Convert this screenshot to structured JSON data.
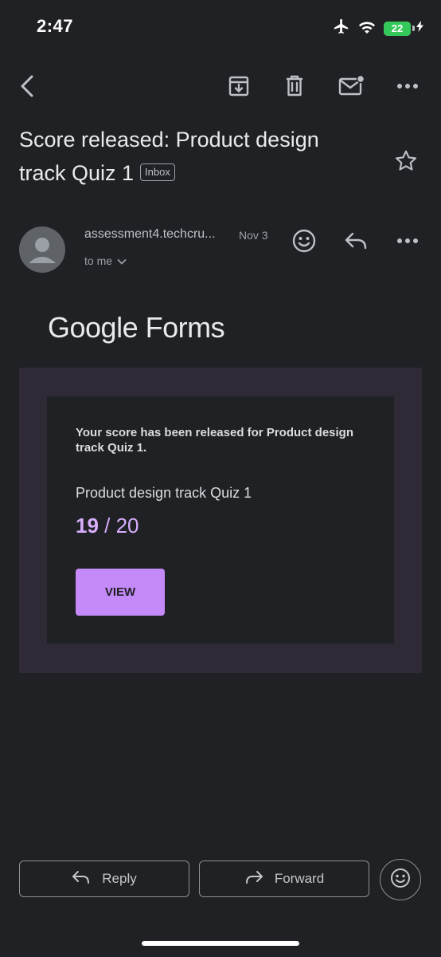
{
  "status_bar": {
    "time": "2:47",
    "battery_level": "22",
    "battery_fraction": 0.22,
    "icons": [
      "airplane-icon",
      "wifi-icon",
      "battery-icon",
      "charging-bolt-icon"
    ]
  },
  "toolbar": {
    "icons": [
      "back-arrow-icon",
      "archive-icon",
      "trash-icon",
      "mark-unread-icon",
      "more-vert-icon"
    ]
  },
  "email": {
    "subject": "Score released: Product design track Quiz 1",
    "label": "Inbox",
    "sender": "assessment4.techcru...",
    "date": "Nov 3",
    "recipient": "to me"
  },
  "body": {
    "brand_google": "Google",
    "brand_forms": "Forms",
    "message": "Your score has been released for Product design track Quiz 1.",
    "quiz_title": "Product design track Quiz 1",
    "score": "19",
    "score_sep": " / ",
    "total": "20",
    "view_label": "VIEW"
  },
  "actions": {
    "reply_label": "Reply",
    "forward_label": "Forward"
  },
  "colors": {
    "background": "#202124",
    "accent": "#c58af9",
    "score_color": "#d7aefb",
    "card_border": "#2f2a36",
    "battery_green": "#34c759"
  }
}
